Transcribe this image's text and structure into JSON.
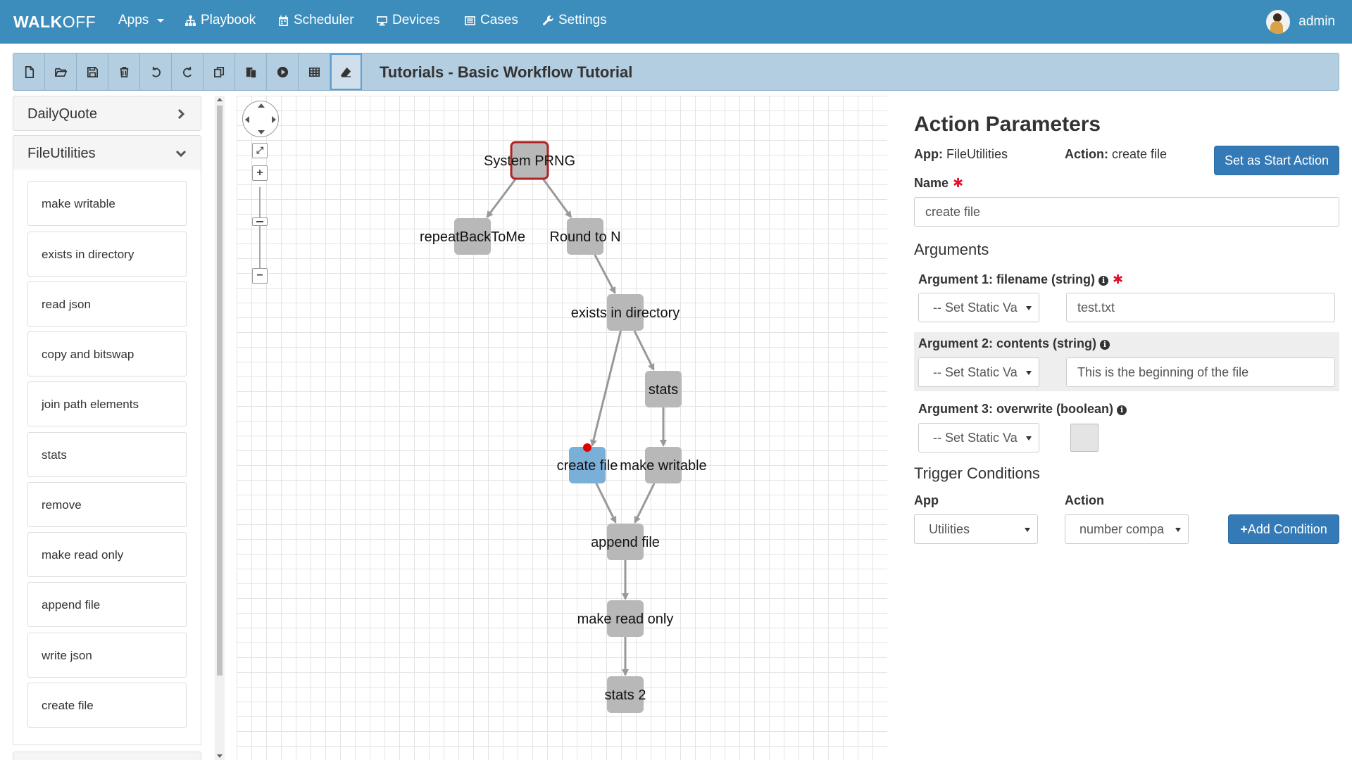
{
  "navbar": {
    "brand_bold": "WALK",
    "brand_rest": "OFF",
    "items": [
      {
        "label": "Apps",
        "icon": "caret-down-icon"
      },
      {
        "label": "Playbook",
        "icon": "sitemap-icon"
      },
      {
        "label": "Scheduler",
        "icon": "calendar-icon"
      },
      {
        "label": "Devices",
        "icon": "monitor-icon"
      },
      {
        "label": "Cases",
        "icon": "list-alt-icon"
      },
      {
        "label": "Settings",
        "icon": "wrench-icon"
      }
    ],
    "user": "admin"
  },
  "toolbar": {
    "buttons": [
      "new-file",
      "open-folder",
      "save",
      "delete",
      "undo",
      "redo",
      "copy",
      "paste",
      "execute",
      "table",
      "eraser"
    ],
    "title": "Tutorials - Basic Workflow Tutorial"
  },
  "sidebar": {
    "apps": [
      {
        "name": "DailyQuote",
        "expanded": false
      },
      {
        "name": "FileUtilities",
        "expanded": true
      }
    ],
    "actions": [
      "make writable",
      "exists in directory",
      "read json",
      "copy and bitswap",
      "join path elements",
      "stats",
      "remove",
      "make read only",
      "append file",
      "write json",
      "create file"
    ]
  },
  "graph": {
    "nodes": [
      {
        "id": "prng",
        "label": "System PRNG",
        "state": "start"
      },
      {
        "id": "repeat",
        "label": "repeatBackToMe",
        "state": "normal"
      },
      {
        "id": "round",
        "label": "Round to N",
        "state": "normal"
      },
      {
        "id": "exists",
        "label": "exists in directory",
        "state": "normal"
      },
      {
        "id": "stats",
        "label": "stats",
        "state": "normal"
      },
      {
        "id": "create",
        "label": "create file",
        "state": "selected"
      },
      {
        "id": "writable",
        "label": "make writable",
        "state": "normal"
      },
      {
        "id": "append",
        "label": "append file",
        "state": "normal"
      },
      {
        "id": "readonly",
        "label": "make read only",
        "state": "normal"
      },
      {
        "id": "stats2",
        "label": "stats 2",
        "state": "normal"
      }
    ],
    "edges": [
      [
        "prng",
        "repeat"
      ],
      [
        "prng",
        "round"
      ],
      [
        "round",
        "exists"
      ],
      [
        "exists",
        "create"
      ],
      [
        "exists",
        "stats"
      ],
      [
        "stats",
        "writable"
      ],
      [
        "create",
        "append"
      ],
      [
        "writable",
        "append"
      ],
      [
        "append",
        "readonly"
      ],
      [
        "readonly",
        "stats2"
      ]
    ],
    "colors": {
      "node": "#b8b8b8",
      "selected": "#7ab0d8",
      "start_border": "#b22222",
      "edge": "#999999",
      "marker": "#e00000"
    }
  },
  "params": {
    "title": "Action Parameters",
    "app_key": "App:",
    "app_value": "FileUtilities",
    "action_key": "Action:",
    "action_value": "create file",
    "start_button": "Set as Start Action",
    "name_label": "Name",
    "required_mark": "✱",
    "name_value": "create file",
    "arguments_heading": "Arguments",
    "arguments": [
      {
        "label": "Argument 1: filename (string)",
        "required": true,
        "source": "-- Set Static Va",
        "value": "test.txt"
      },
      {
        "label": "Argument 2: contents (string)",
        "required": false,
        "source": "-- Set Static Va",
        "value": "This is the beginning of the file"
      },
      {
        "label": "Argument 3: overwrite (boolean)",
        "required": false,
        "source": "-- Set Static Va",
        "value": ""
      }
    ],
    "trigger_heading": "Trigger Conditions",
    "trigger_app_label": "App",
    "trigger_action_label": "Action",
    "trigger_app_value": "Utilities",
    "trigger_action_value": "number compa",
    "add_condition": "Add Condition",
    "add_icon": "+"
  }
}
